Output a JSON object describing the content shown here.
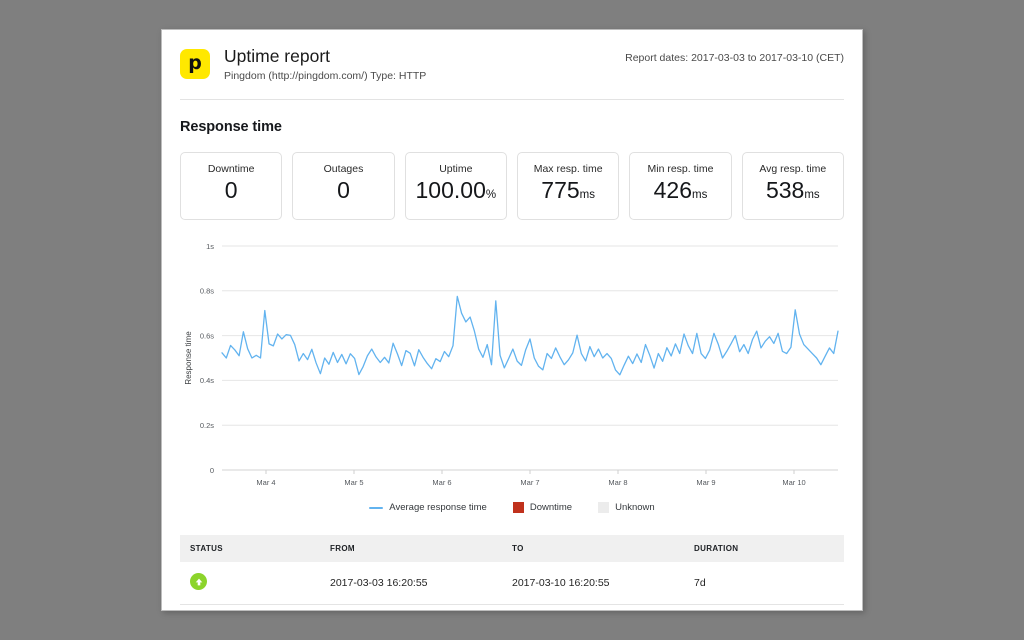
{
  "report": {
    "logo_glyph": "p",
    "title": "Uptime report",
    "subtitle": "Pingdom (http://pingdom.com/) Type: HTTP",
    "dates": "Report dates: 2017-03-03 to 2017-03-10 (CET)",
    "section_title": "Response time"
  },
  "stats": [
    {
      "label": "Downtime",
      "value": "0",
      "unit": ""
    },
    {
      "label": "Outages",
      "value": "0",
      "unit": ""
    },
    {
      "label": "Uptime",
      "value": "100.00",
      "unit": "%"
    },
    {
      "label": "Max resp. time",
      "value": "775",
      "unit": "ms"
    },
    {
      "label": "Min resp. time",
      "value": "426",
      "unit": "ms"
    },
    {
      "label": "Avg resp. time",
      "value": "538",
      "unit": "ms"
    }
  ],
  "legend": [
    {
      "label": "Average response time",
      "swatch": "line",
      "color": "#62b3ef"
    },
    {
      "label": "Downtime",
      "swatch": "box",
      "color": "#c0311c"
    },
    {
      "label": "Unknown",
      "swatch": "box",
      "color": "#ececec"
    }
  ],
  "table": {
    "headers": [
      "STATUS",
      "FROM",
      "TO",
      "DURATION"
    ],
    "rows": [
      {
        "status_icon": "arrow-up-green-icon",
        "from": "2017-03-03 16:20:55",
        "to": "2017-03-10 16:20:55",
        "duration": "7d"
      }
    ]
  },
  "chart_data": {
    "type": "line",
    "title": "Response time",
    "xlabel": "",
    "ylabel": "Response time",
    "ylim": [
      0,
      1
    ],
    "ytick_labels": [
      "0",
      "0.2s",
      "0.4s",
      "0.6s",
      "0.8s",
      "1s"
    ],
    "ytick_values": [
      0,
      0.2,
      0.4,
      0.6,
      0.8,
      1
    ],
    "xtick_labels": [
      "Mar 4",
      "Mar 5",
      "Mar 6",
      "Mar 7",
      "Mar 8",
      "Mar 9",
      "Mar 10"
    ],
    "grid": true,
    "legend_position": "bottom",
    "series": [
      {
        "name": "Average response time",
        "color": "#62b3ef",
        "unit": "s",
        "values": [
          0.523,
          0.5,
          0.556,
          0.536,
          0.51,
          0.617,
          0.541,
          0.5,
          0.512,
          0.5,
          0.712,
          0.563,
          0.554,
          0.607,
          0.585,
          0.604,
          0.601,
          0.56,
          0.487,
          0.52,
          0.493,
          0.539,
          0.478,
          0.43,
          0.5,
          0.472,
          0.525,
          0.48,
          0.516,
          0.474,
          0.519,
          0.498,
          0.426,
          0.462,
          0.51,
          0.54,
          0.505,
          0.48,
          0.503,
          0.478,
          0.566,
          0.519,
          0.466,
          0.533,
          0.521,
          0.465,
          0.537,
          0.503,
          0.475,
          0.452,
          0.497,
          0.484,
          0.529,
          0.506,
          0.555,
          0.775,
          0.7,
          0.661,
          0.683,
          0.62,
          0.54,
          0.503,
          0.56,
          0.47,
          0.755,
          0.512,
          0.456,
          0.497,
          0.54,
          0.486,
          0.467,
          0.537,
          0.585,
          0.5,
          0.463,
          0.447,
          0.52,
          0.498,
          0.545,
          0.505,
          0.47,
          0.492,
          0.523,
          0.602,
          0.52,
          0.487,
          0.551,
          0.506,
          0.54,
          0.5,
          0.52,
          0.498,
          0.446,
          0.425,
          0.468,
          0.508,
          0.475,
          0.518,
          0.48,
          0.56,
          0.512,
          0.455,
          0.52,
          0.485,
          0.546,
          0.509,
          0.563,
          0.52,
          0.607,
          0.555,
          0.52,
          0.61,
          0.52,
          0.498,
          0.535,
          0.61,
          0.562,
          0.5,
          0.53,
          0.564,
          0.6,
          0.528,
          0.56,
          0.52,
          0.582,
          0.62,
          0.545,
          0.575,
          0.595,
          0.565,
          0.61,
          0.53,
          0.52,
          0.548,
          0.715,
          0.607,
          0.56,
          0.54,
          0.52,
          0.5,
          0.47,
          0.508,
          0.545,
          0.52,
          0.62
        ]
      }
    ]
  }
}
